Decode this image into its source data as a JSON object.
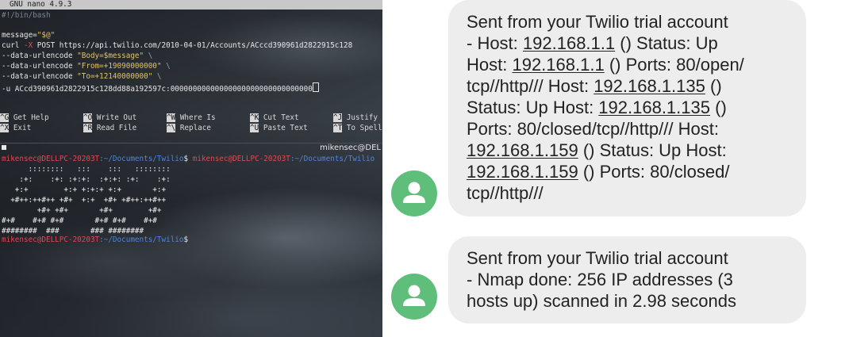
{
  "terminal": {
    "nano": {
      "title": "GNU nano 4.9.3",
      "lines": {
        "shebang": "#!/bin/bash",
        "msg_var": "message=",
        "msg_val": "\"$@\"",
        "curl": "curl",
        "curl_flag": " -X ",
        "curl_rest": "POST https://api.twilio.com/2010-04-01/Accounts/ACccd390961d2822915c128",
        "opt1": "--data-urlencode ",
        "val1": "\"Body=$message\"",
        "opt2": "--data-urlencode ",
        "val2": "\"From=+19090000000\"",
        "opt3": "--data-urlencode ",
        "val3": "\"To=+12140000000\"",
        "auth_prefix": "-u ACcd390961d2822915c128dd88a192597c:",
        "auth_token": "00000000000000000000000000000000",
        "cont": " \\"
      },
      "shortcuts": [
        {
          "key": "^G",
          "label": "Get Help"
        },
        {
          "key": "^O",
          "label": "Write Out"
        },
        {
          "key": "^W",
          "label": "Where Is"
        },
        {
          "key": "^K",
          "label": "Cut Text"
        },
        {
          "key": "^J",
          "label": "Justify"
        },
        {
          "key": "^X",
          "label": "Exit"
        },
        {
          "key": "^R",
          "label": "Read File"
        },
        {
          "key": "^\\",
          "label": "Replace"
        },
        {
          "key": "^U",
          "label": "Paste Text"
        },
        {
          "key": "^T",
          "label": "To Spell"
        }
      ]
    },
    "shell": {
      "window_user": "mikensec@DEL",
      "prompt_user": "mikensec@DELLPC-20203T",
      "prompt_path": ":~/Documents/Twilio",
      "dollar": "$",
      "art": [
        "      ::::::::   :::    :::   ::::::::",
        "    :+:    :+: :+:+:  :+:+: :+:    :+:",
        "   +:+        +:+ +:+:+ +:+       +:+",
        "  +#++:++#++ +#+  +:+  +#+ +#++:++#++",
        "        +#+ +#+       +#+        +#+",
        "#+#    #+# #+#       #+# #+#    #+#",
        "########  ###       ### ########"
      ]
    }
  },
  "messages": [
    {
      "lines": [
        [
          {
            "t": "Sent from your Twilio trial account"
          }
        ],
        [
          {
            "t": "- Host: "
          },
          {
            "t": "192.168.1.1",
            "link": true
          },
          {
            "t": " () Status: Up"
          }
        ],
        [
          {
            "t": "Host: "
          },
          {
            "t": "192.168.1.1",
            "link": true
          },
          {
            "t": " () Ports: 80/open/"
          }
        ],
        [
          {
            "t": "tcp//http/// Host: "
          },
          {
            "t": "192.168.1.135",
            "link": true
          },
          {
            "t": " ()"
          }
        ],
        [
          {
            "t": "Status: Up Host: "
          },
          {
            "t": "192.168.1.135",
            "link": true
          },
          {
            "t": " ()"
          }
        ],
        [
          {
            "t": "Ports: 80/closed/tcp//http/// Host:"
          }
        ],
        [
          {
            "t": "192.168.1.159",
            "link": true
          },
          {
            "t": " () Status: Up Host:"
          }
        ],
        [
          {
            "t": "192.168.1.159",
            "link": true
          },
          {
            "t": " () Ports: 80/closed/"
          }
        ],
        [
          {
            "t": "tcp//http///"
          }
        ]
      ]
    },
    {
      "lines": [
        [
          {
            "t": "Sent from your Twilio trial account"
          }
        ],
        [
          {
            "t": "- Nmap done: 256 IP addresses (3"
          }
        ],
        [
          {
            "t": "hosts up) scanned in 2.98 seconds"
          }
        ]
      ]
    }
  ],
  "colors": {
    "avatar": "#5fbf7a",
    "bubble": "#ededed",
    "prompt": "#e0484f",
    "path": "#4d86d6",
    "string": "#e0c36a"
  },
  "icons": {
    "avatar": "person-icon"
  }
}
